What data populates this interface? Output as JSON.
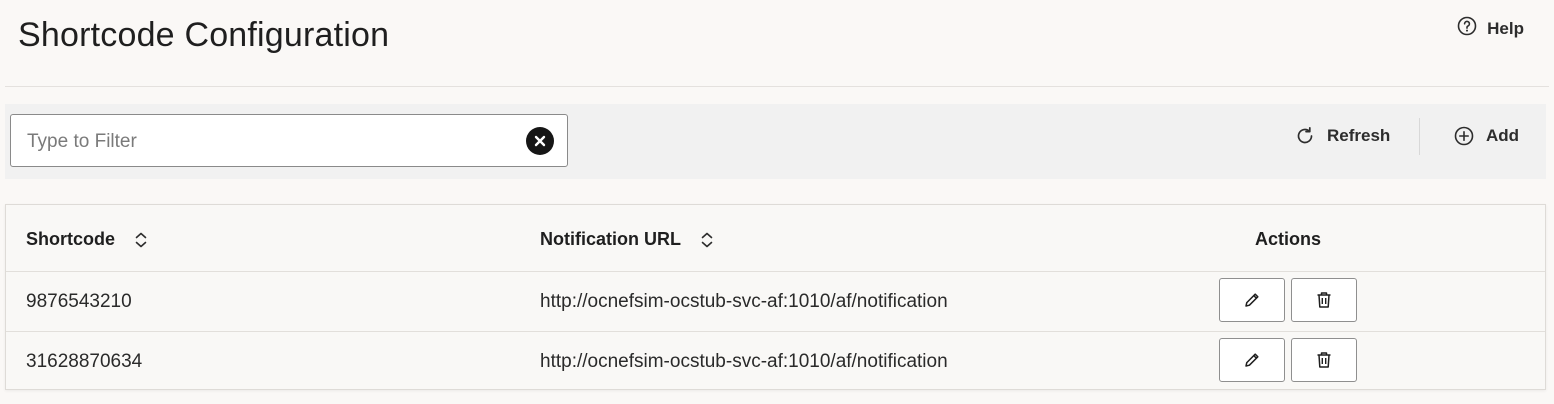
{
  "header": {
    "title": "Shortcode Configuration",
    "help_label": "Help"
  },
  "toolbar": {
    "filter_placeholder": "Type to Filter",
    "filter_value": "",
    "refresh_label": "Refresh",
    "add_label": "Add"
  },
  "table": {
    "columns": {
      "shortcode": "Shortcode",
      "notification_url": "Notification URL",
      "actions": "Actions"
    },
    "rows": [
      {
        "shortcode": "9876543210",
        "notification_url": "http://ocnefsim-ocstub-svc-af:1010/af/notification"
      },
      {
        "shortcode": "31628870634",
        "notification_url": "http://ocnefsim-ocstub-svc-af:1010/af/notification"
      }
    ]
  },
  "icons": {
    "help": "help-circle-icon",
    "clear": "clear-x-icon",
    "refresh": "refresh-icon",
    "add": "add-circle-icon",
    "sort": "sort-icon",
    "edit": "pencil-icon",
    "delete": "trash-icon"
  }
}
